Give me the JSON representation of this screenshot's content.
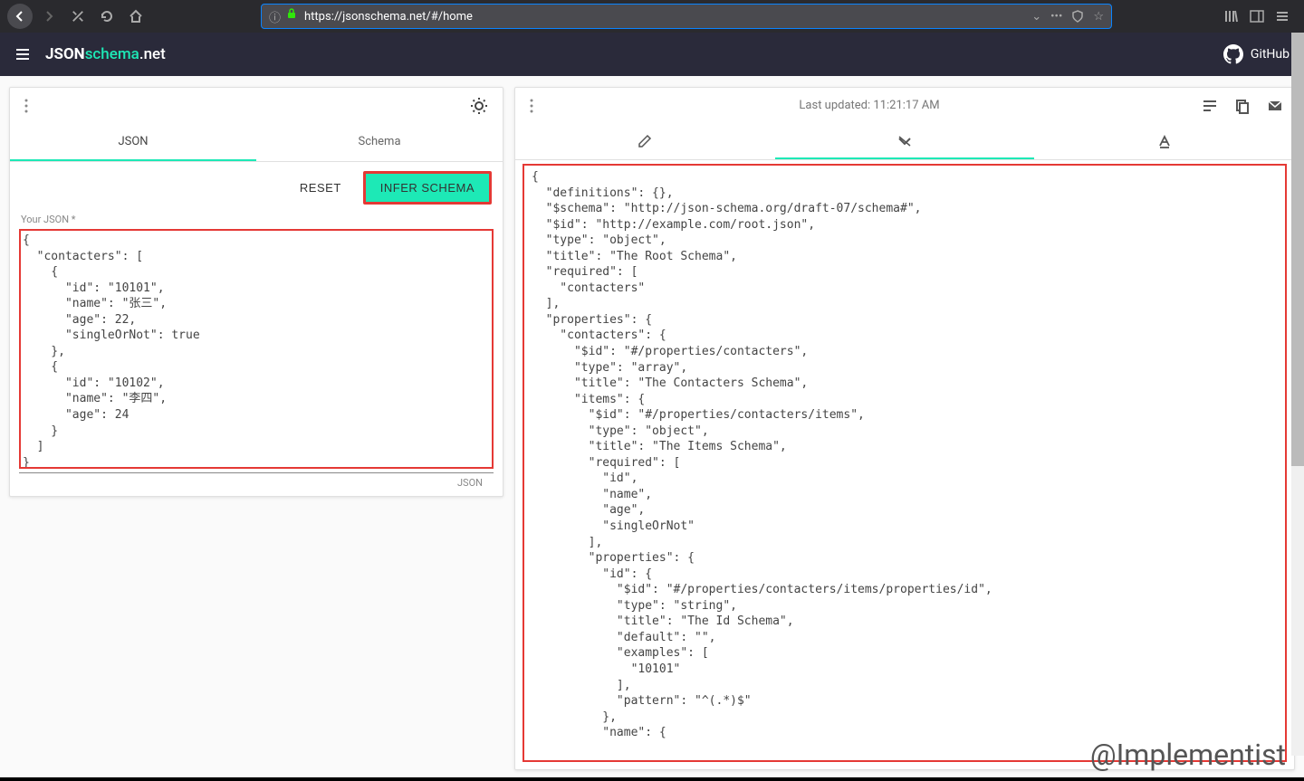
{
  "browser": {
    "url": "https://jsonschema.net/#/home"
  },
  "app": {
    "title_json": "JSON",
    "title_schema": "schema",
    "title_net": ".net",
    "github_label": "GitHub"
  },
  "left_panel": {
    "tabs": {
      "json": "JSON",
      "schema": "Schema"
    },
    "buttons": {
      "reset": "RESET",
      "infer": "INFER SCHEMA"
    },
    "input_label": "Your JSON *",
    "helper_text": "JSON",
    "json_content": "{\n  \"contacters\": [\n    {\n      \"id\": \"10101\",\n      \"name\": \"张三\",\n      \"age\": 22,\n      \"singleOrNot\": true\n    },\n    {\n      \"id\": \"10102\",\n      \"name\": \"李四\",\n      \"age\": 24\n    }\n  ]\n}"
  },
  "right_panel": {
    "status": "Last updated: 11:21:17 AM",
    "schema_content": "{\n  \"definitions\": {},\n  \"$schema\": \"http://json-schema.org/draft-07/schema#\",\n  \"$id\": \"http://example.com/root.json\",\n  \"type\": \"object\",\n  \"title\": \"The Root Schema\",\n  \"required\": [\n    \"contacters\"\n  ],\n  \"properties\": {\n    \"contacters\": {\n      \"$id\": \"#/properties/contacters\",\n      \"type\": \"array\",\n      \"title\": \"The Contacters Schema\",\n      \"items\": {\n        \"$id\": \"#/properties/contacters/items\",\n        \"type\": \"object\",\n        \"title\": \"The Items Schema\",\n        \"required\": [\n          \"id\",\n          \"name\",\n          \"age\",\n          \"singleOrNot\"\n        ],\n        \"properties\": {\n          \"id\": {\n            \"$id\": \"#/properties/contacters/items/properties/id\",\n            \"type\": \"string\",\n            \"title\": \"The Id Schema\",\n            \"default\": \"\",\n            \"examples\": [\n              \"10101\"\n            ],\n            \"pattern\": \"^(.*)$\"\n          },\n          \"name\": {"
  },
  "watermark": "@Implementist"
}
